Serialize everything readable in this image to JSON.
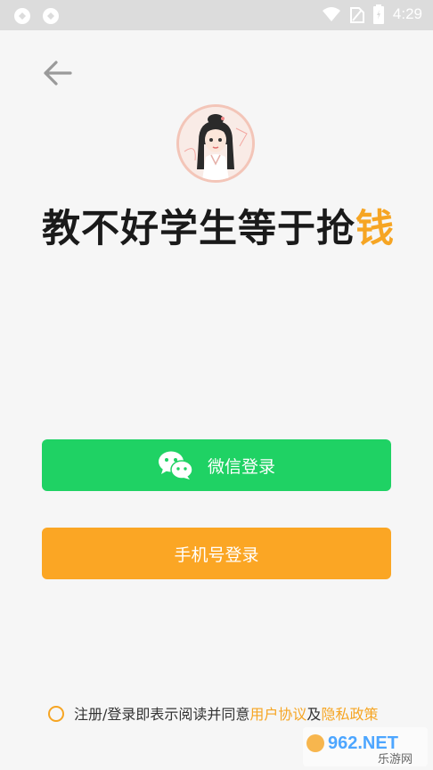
{
  "status_bar": {
    "time": "4:29",
    "icons": [
      "sync-icon",
      "sync-icon",
      "wifi-icon",
      "no-sim-icon",
      "battery-icon"
    ]
  },
  "header": {
    "back_icon": "arrow-left-icon"
  },
  "slogan": {
    "main": "教不好学生等于抢",
    "accent": "钱"
  },
  "buttons": {
    "wechat_label": "微信登录",
    "phone_label": "手机号登录"
  },
  "agreement": {
    "prefix": "注册/登录即表示阅读并同意",
    "user_agreement": "用户协议",
    "and": "及",
    "privacy_policy": "隐私政策"
  },
  "watermark": {
    "brand": "962.NET",
    "sub": "乐游网"
  },
  "colors": {
    "wechat_green": "#1fd264",
    "orange": "#fba624",
    "accent": "#f6a523"
  }
}
